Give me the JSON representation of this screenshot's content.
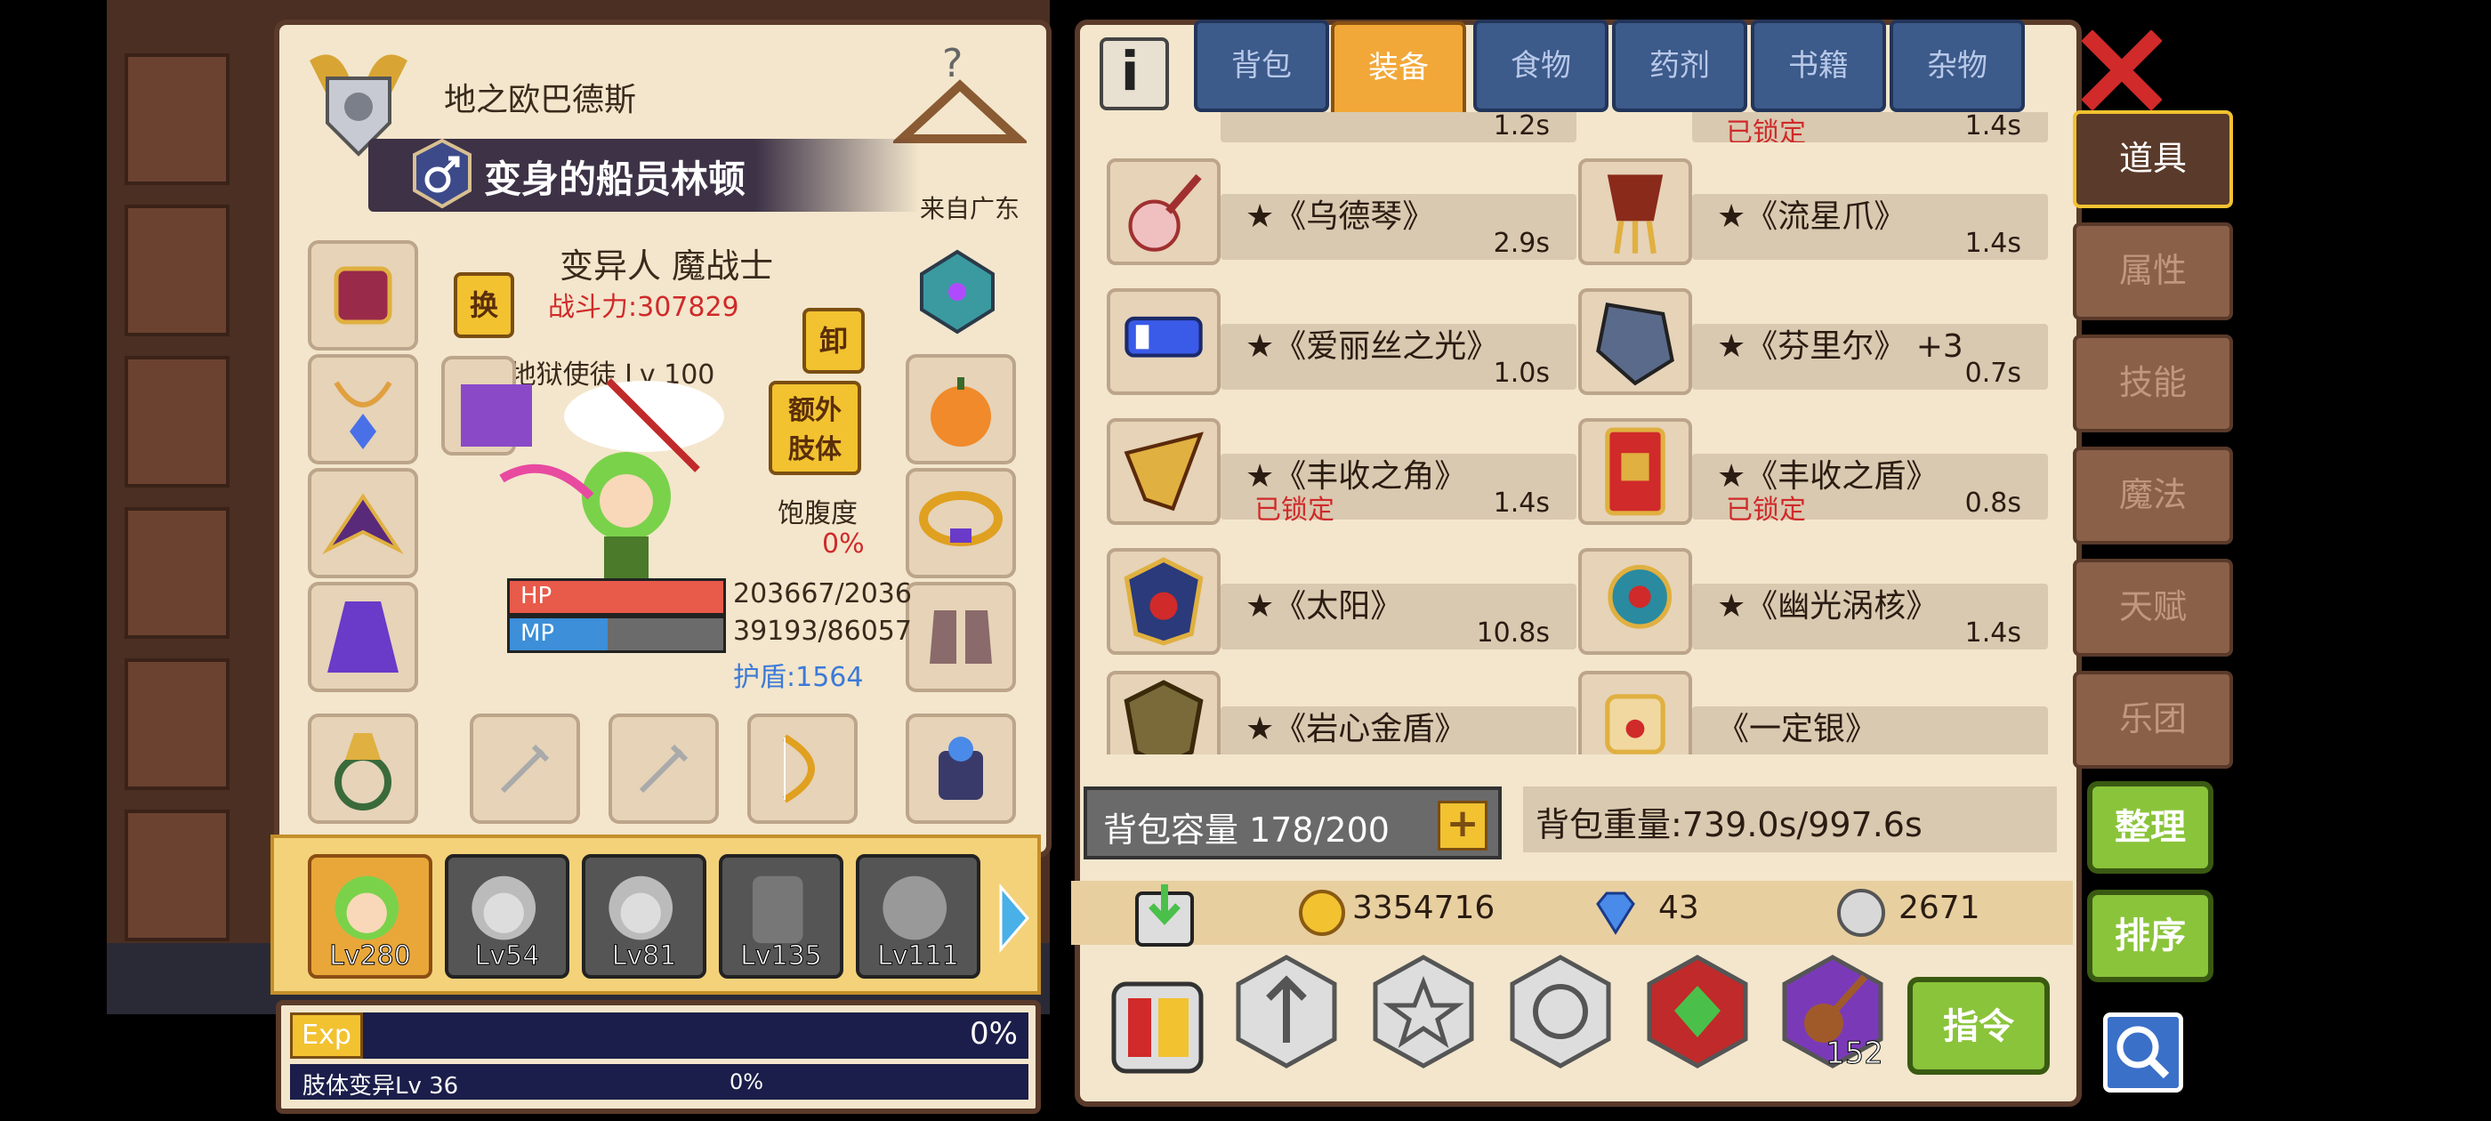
{
  "character": {
    "player_name": "地之欧巴德斯",
    "title": "变身的船员林顿",
    "origin": "来自广东",
    "race_class": "变异人 魔战士",
    "power": "战斗力:307829",
    "rank": "S阶 地狱使徒 Lv 100",
    "swap_label": "换",
    "unequip_label": "卸",
    "extra_limb_label_1": "额外",
    "extra_limb_label_2": "肢体",
    "satiety_label": "饱腹度",
    "satiety_value": "0%",
    "hp_label": "HP",
    "hp_value": "203667/2036",
    "hp_fraction": 1.0,
    "mp_label": "MP",
    "mp_value": "39193/86057",
    "mp_fraction": 0.46,
    "shield": "护盾:1564"
  },
  "party": [
    {
      "level": "Lv280",
      "active": true
    },
    {
      "level": "Lv54",
      "active": false
    },
    {
      "level": "Lv81",
      "active": false
    },
    {
      "level": "Lv135",
      "active": false
    },
    {
      "level": "Lv111",
      "active": false
    }
  ],
  "exp": {
    "tag": "Exp",
    "percent": "0%",
    "limb_label": "肢体变异Lv 36",
    "limb_percent": "0%"
  },
  "tabs": [
    "背包",
    "装备",
    "食物",
    "药剂",
    "书籍",
    "杂物"
  ],
  "active_tab": "装备",
  "items_partial": {
    "left_weight": "1.2s",
    "right_locked": "已锁定",
    "right_weight": "1.4s"
  },
  "items": [
    {
      "name": "★《乌德琴》",
      "weight": "2.9s",
      "locked": ""
    },
    {
      "name": "★《流星爪》",
      "weight": "1.4s",
      "locked": ""
    },
    {
      "name": "★《爱丽丝之光》",
      "weight": "1.0s",
      "locked": ""
    },
    {
      "name": "★《芬里尔》 +3",
      "weight": "0.7s",
      "locked": ""
    },
    {
      "name": "★《丰收之角》",
      "weight": "1.4s",
      "locked": "已锁定"
    },
    {
      "name": "★《丰收之盾》",
      "weight": "0.8s",
      "locked": "已锁定"
    },
    {
      "name": "★《太阳》",
      "weight": "10.8s",
      "locked": ""
    },
    {
      "name": "★《幽光涡核》",
      "weight": "1.4s",
      "locked": ""
    },
    {
      "name": "★《岩心金盾》",
      "weight": "",
      "locked": ""
    },
    {
      "name": "《一定银》",
      "weight": "",
      "locked": ""
    }
  ],
  "capacity": "背包容量 178/200",
  "capacity_plus": "+",
  "bag_weight": "背包重量:739.0s/997.6s",
  "currency": {
    "gold": "3354716",
    "gems": "43",
    "silver": "2671"
  },
  "bottom_bar": {
    "bag_count": "152",
    "command_label": "指令"
  },
  "side_tabs": [
    "道具",
    "属性",
    "技能",
    "魔法",
    "天赋",
    "乐团"
  ],
  "active_side_tab": "道具",
  "buttons": {
    "organize": "整理",
    "sort": "排序"
  },
  "colors": {
    "panel_bg": "#f3e6cc",
    "tab_active": "#f2a838",
    "tab_inactive": "#3c5a8a",
    "locked_red": "#d02a2a",
    "green_button": "#8ac43a"
  }
}
